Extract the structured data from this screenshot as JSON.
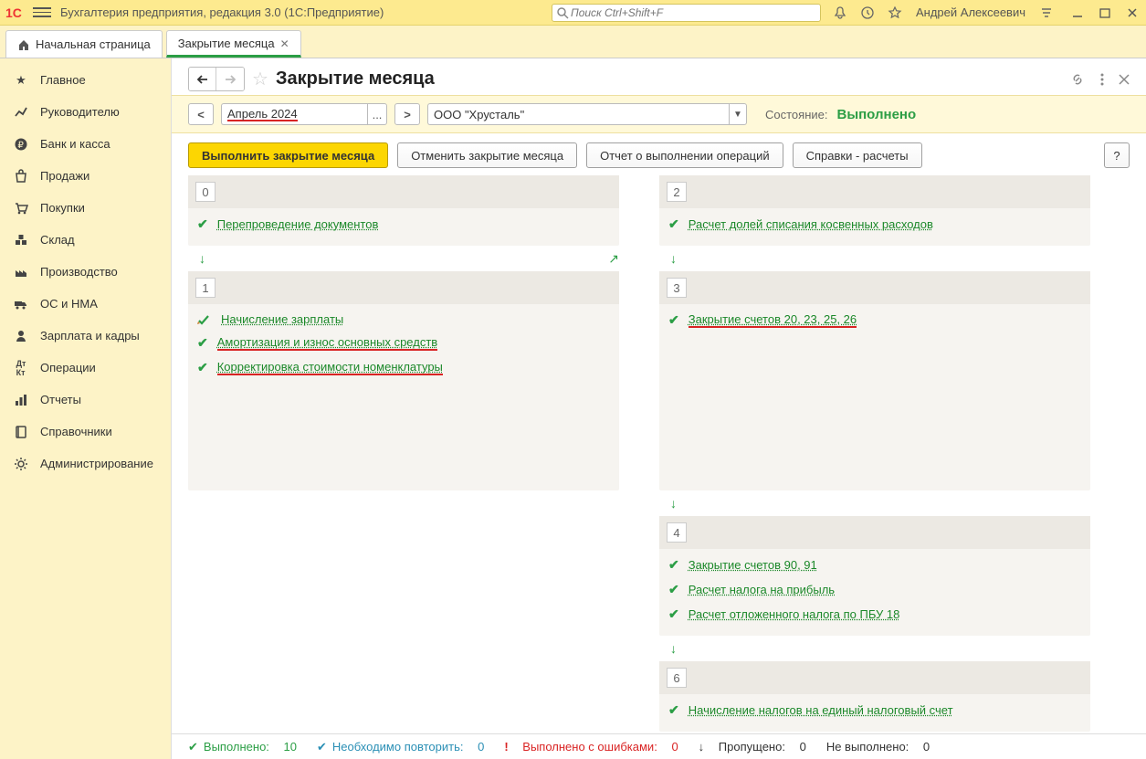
{
  "app": {
    "title": "Бухгалтерия предприятия, редакция 3.0  (1С:Предприятие)",
    "search_placeholder": "Поиск Ctrl+Shift+F",
    "username": "Андрей Алексеевич"
  },
  "tabs": [
    {
      "label": "Начальная страница"
    },
    {
      "label": "Закрытие месяца"
    }
  ],
  "sidebar": {
    "items": [
      {
        "label": "Главное"
      },
      {
        "label": "Руководителю"
      },
      {
        "label": "Банк и касса"
      },
      {
        "label": "Продажи"
      },
      {
        "label": "Покупки"
      },
      {
        "label": "Склад"
      },
      {
        "label": "Производство"
      },
      {
        "label": "ОС и НМА"
      },
      {
        "label": "Зарплата и кадры"
      },
      {
        "label": "Операции"
      },
      {
        "label": "Отчеты"
      },
      {
        "label": "Справочники"
      },
      {
        "label": "Администрирование"
      }
    ]
  },
  "page": {
    "title": "Закрытие месяца",
    "nav_back": "←",
    "nav_forward": "→",
    "params": {
      "prev": "<",
      "next": ">",
      "period": "Апрель 2024",
      "period_ellipsis": "...",
      "org": "ООО \"Хрусталь\"",
      "state_label": "Состояние:",
      "state_value": "Выполнено"
    },
    "toolbar": {
      "execute": "Выполнить закрытие месяца",
      "cancel": "Отменить закрытие месяца",
      "report": "Отчет о выполнении операций",
      "refs": "Справки - расчеты",
      "help": "?"
    },
    "stages": {
      "s0": {
        "num": "0",
        "ops": [
          {
            "label": "Перепроведение документов"
          }
        ]
      },
      "s1": {
        "num": "1",
        "ops": [
          {
            "label": "Начисление зарплаты"
          },
          {
            "label": "Амортизация и износ основных средств"
          },
          {
            "label": "Корректировка стоимости номенклатуры"
          }
        ]
      },
      "s2": {
        "num": "2",
        "ops": [
          {
            "label": "Расчет долей списания косвенных расходов"
          }
        ]
      },
      "s3": {
        "num": "3",
        "ops": [
          {
            "label": "Закрытие счетов 20, 23, 25, 26"
          }
        ]
      },
      "s4": {
        "num": "4",
        "ops": [
          {
            "label": "Закрытие счетов 90, 91"
          },
          {
            "label": "Расчет налога на прибыль"
          },
          {
            "label": "Расчет отложенного налога по ПБУ 18"
          }
        ]
      },
      "s6": {
        "num": "6",
        "ops": [
          {
            "label": "Начисление налогов на единый налоговый счет"
          }
        ]
      }
    },
    "status": {
      "done_label": "Выполнено:",
      "done_val": "10",
      "repeat_label": "Необходимо повторить:",
      "repeat_val": "0",
      "err_label": "Выполнено с ошибками:",
      "err_val": "0",
      "skip_label": "Пропущено:",
      "skip_val": "0",
      "not_label": "Не выполнено:",
      "not_val": "0"
    }
  }
}
